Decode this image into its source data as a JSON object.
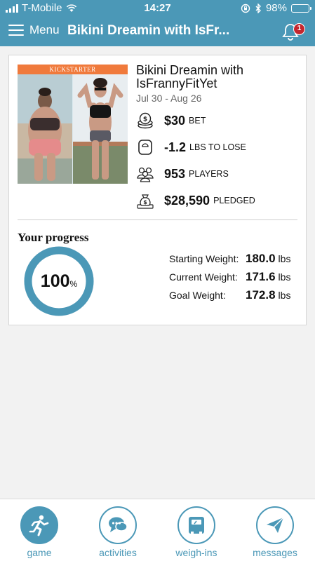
{
  "status_bar": {
    "carrier": "T-Mobile",
    "time": "14:27",
    "battery": "98%"
  },
  "nav": {
    "menu_label": "Menu",
    "title": "Bikini Dreamin with IsFr...",
    "notification_count": "1"
  },
  "game": {
    "photo_banner": "KICKSTARTER",
    "title": "Bikini Dreamin with IsFrannyFitYet",
    "dates": "Jul 30 - Aug 26",
    "stats": [
      {
        "icon": "coins-icon",
        "value": "$30",
        "label": "BET"
      },
      {
        "icon": "scale-icon",
        "value": "-1.2",
        "label": "LBS TO LOSE"
      },
      {
        "icon": "players-icon",
        "value": "953",
        "label": "PLAYERS"
      },
      {
        "icon": "money-bag-icon",
        "value": "$28,590",
        "label": "PLEDGED"
      }
    ]
  },
  "progress": {
    "title": "Your progress",
    "percent_value": "100",
    "percent_symbol": "%",
    "percent": 100,
    "starting_label": "Starting Weight:",
    "starting_value": "180.0",
    "current_label": "Current Weight:",
    "current_value": "171.6",
    "goal_label": "Goal Weight:",
    "goal_value": "172.8",
    "unit": "lbs"
  },
  "tabs": [
    {
      "label": "game",
      "icon": "running-person-icon",
      "active": true
    },
    {
      "label": "activities",
      "icon": "chat-bubble-icon",
      "active": false
    },
    {
      "label": "weigh-ins",
      "icon": "scale-icon",
      "active": false
    },
    {
      "label": "messages",
      "icon": "paper-plane-icon",
      "active": false
    }
  ],
  "colors": {
    "brand": "#4b98b7",
    "badge": "#c4262e",
    "banner": "#f07a3c"
  }
}
